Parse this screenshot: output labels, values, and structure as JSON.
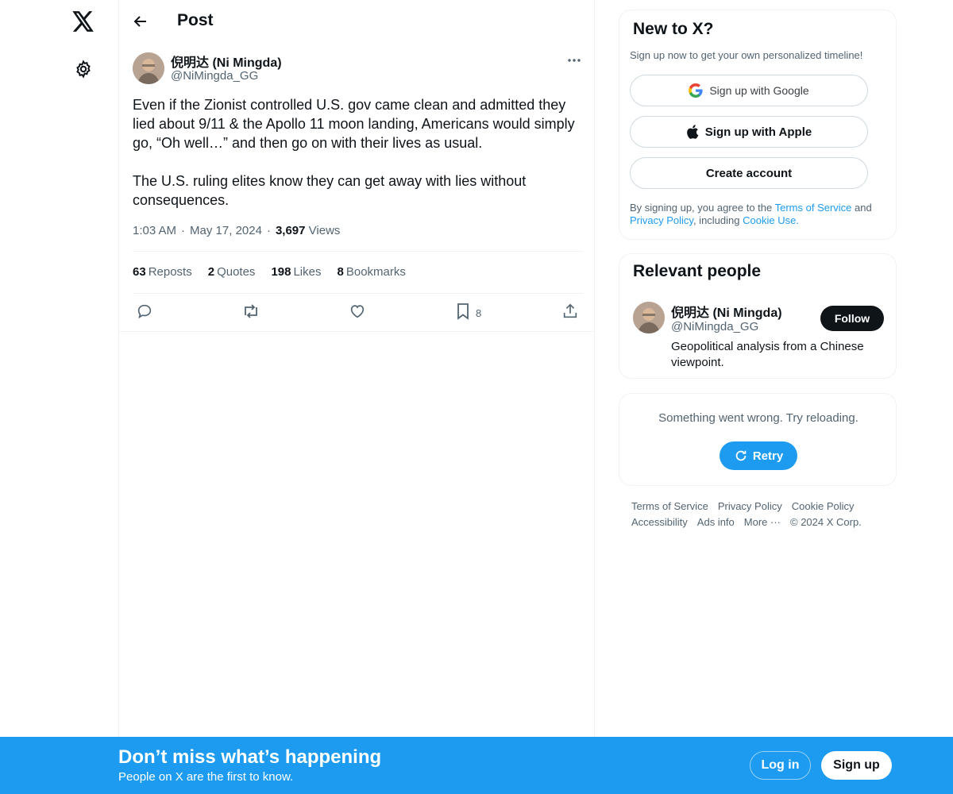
{
  "header": {
    "title": "Post"
  },
  "post": {
    "author_name": "倪明达 (Ni Mingda)",
    "author_handle": "@NiMingda_GG",
    "paragraphs": [
      "Even if the Zionist controlled U.S. gov came clean and admitted they lied about 9/11 & the Apollo 11 moon landing, Americans would simply go, “Oh well…” and then go on with their lives as usual.",
      "The U.S. ruling elites know they can get away with lies without consequences."
    ],
    "time": "1:03 AM",
    "date": "May 17, 2024",
    "views_count": "3,697",
    "views_label": "Views",
    "stats": {
      "reposts_count": "63",
      "reposts_label": "Reposts",
      "quotes_count": "2",
      "quotes_label": "Quotes",
      "likes_count": "198",
      "likes_label": "Likes",
      "bookmarks_count": "8",
      "bookmarks_label": "Bookmarks"
    },
    "actions": {
      "bookmark_count": "8"
    }
  },
  "sidebar": {
    "new_to_x": {
      "title": "New to X?",
      "subtitle": "Sign up now to get your own personalized timeline!",
      "google_label": "Sign up with Google",
      "apple_label": "Sign up with Apple",
      "create_label": "Create account",
      "legal_prefix": "By signing up, you agree to the ",
      "terms": "Terms of Service",
      "and": " and ",
      "privacy": "Privacy Policy",
      "including": ", including ",
      "cookie": "Cookie Use."
    },
    "relevant": {
      "title": "Relevant people",
      "name": "倪明达 (Ni Mingda)",
      "handle": "@NiMingda_GG",
      "bio": "Geopolitical analysis from a Chinese viewpoint.",
      "follow_label": "Follow"
    },
    "error": {
      "message": "Something went wrong. Try reloading.",
      "retry_label": "Retry"
    },
    "footer": [
      "Terms of Service",
      "Privacy Policy",
      "Cookie Policy",
      "Accessibility",
      "Ads info",
      "More ···",
      "© 2024 X Corp."
    ]
  },
  "bottom_bar": {
    "title": "Don’t miss what’s happening",
    "subtitle": "People on X are the first to know.",
    "login_label": "Log in",
    "signup_label": "Sign up"
  },
  "colors": {
    "accent": "#1d9bf0",
    "text": "#0f1419",
    "secondary": "#536471",
    "border": "#eff3f4"
  }
}
